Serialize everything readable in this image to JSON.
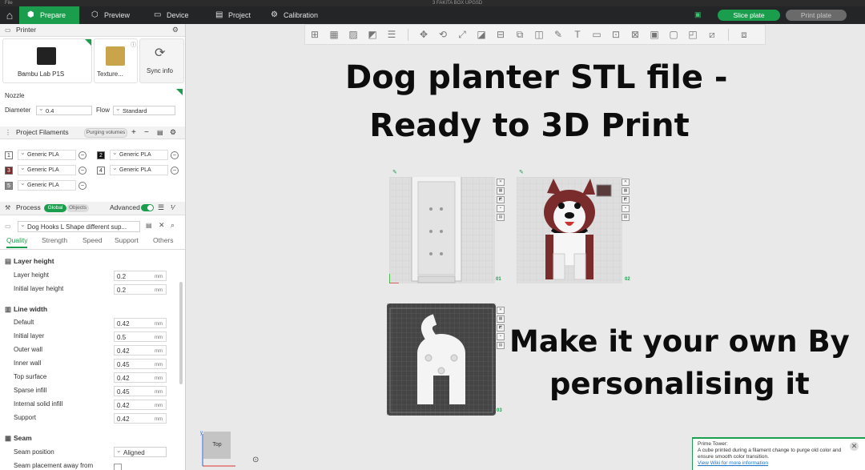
{
  "window": {
    "menu": "File",
    "title": "3 FAKITA BOX UPGSD"
  },
  "tabs": [
    {
      "label": "Prepare",
      "icon": "cube-icon"
    },
    {
      "label": "Preview",
      "icon": "preview-icon"
    },
    {
      "label": "Device",
      "icon": "device-icon"
    },
    {
      "label": "Project",
      "icon": "project-icon"
    },
    {
      "label": "Calibration",
      "icon": "calibration-icon"
    }
  ],
  "actions": {
    "slice": "Slice plate",
    "print": "Print plate"
  },
  "printer": {
    "section": "Printer",
    "name": "Bambu Lab P1S",
    "plate": "Texture...",
    "sync": "Sync info",
    "nozzle_label": "Nozzle",
    "diameter_label": "Diameter",
    "diameter": "0.4",
    "flow_label": "Flow",
    "flow": "Standard"
  },
  "filaments": {
    "section": "Project Filaments",
    "purging": "Purging volumes",
    "items": [
      {
        "num": "1",
        "name": "Generic PLA",
        "color": "#ffffff"
      },
      {
        "num": "2",
        "name": "Generic PLA",
        "color": "#111111"
      },
      {
        "num": "3",
        "name": "Generic PLA",
        "color": "#7a2b2b"
      },
      {
        "num": "4",
        "name": "Generic PLA",
        "color": "#ffffff"
      },
      {
        "num": "5",
        "name": "Generic PLA",
        "color": "#8a8a8a"
      }
    ]
  },
  "process": {
    "section": "Process",
    "global": "Global",
    "objects": "Objects",
    "advanced": "Advanced",
    "preset": "Dog Hooks L Shape different sup...",
    "subtabs": [
      "Quality",
      "Strength",
      "Speed",
      "Support",
      "Others"
    ],
    "layer_height_group": "Layer height",
    "layer_height": [
      {
        "label": "Layer height",
        "value": "0.2",
        "unit": "mm"
      },
      {
        "label": "Initial layer height",
        "value": "0.2",
        "unit": "mm"
      }
    ],
    "line_width_group": "Line width",
    "line_width": [
      {
        "label": "Default",
        "value": "0.42",
        "unit": "mm"
      },
      {
        "label": "Initial layer",
        "value": "0.5",
        "unit": "mm"
      },
      {
        "label": "Outer wall",
        "value": "0.42",
        "unit": "mm"
      },
      {
        "label": "Inner wall",
        "value": "0.45",
        "unit": "mm"
      },
      {
        "label": "Top surface",
        "value": "0.42",
        "unit": "mm"
      },
      {
        "label": "Sparse infill",
        "value": "0.45",
        "unit": "mm"
      },
      {
        "label": "Internal solid infill",
        "value": "0.42",
        "unit": "mm"
      },
      {
        "label": "Support",
        "value": "0.42",
        "unit": "mm"
      }
    ],
    "seam_group": "Seam",
    "seam_position_label": "Seam position",
    "seam_position": "Aligned",
    "seam_away_label": "Seam placement away from"
  },
  "viewport": {
    "headline_1": "Dog planter STL file -",
    "headline_2": "Ready to 3D Print",
    "headline_3": "Make it your own By",
    "headline_4": "personalising it",
    "plate_1": "01",
    "plate_2": "02",
    "plate_3": "03",
    "view_label": "Top"
  },
  "notification": {
    "title": "Prime Tower:",
    "body": "A cube printed during a filament change to purge old color and ensure smooth color transition.",
    "link": "View Wiki for more information"
  }
}
